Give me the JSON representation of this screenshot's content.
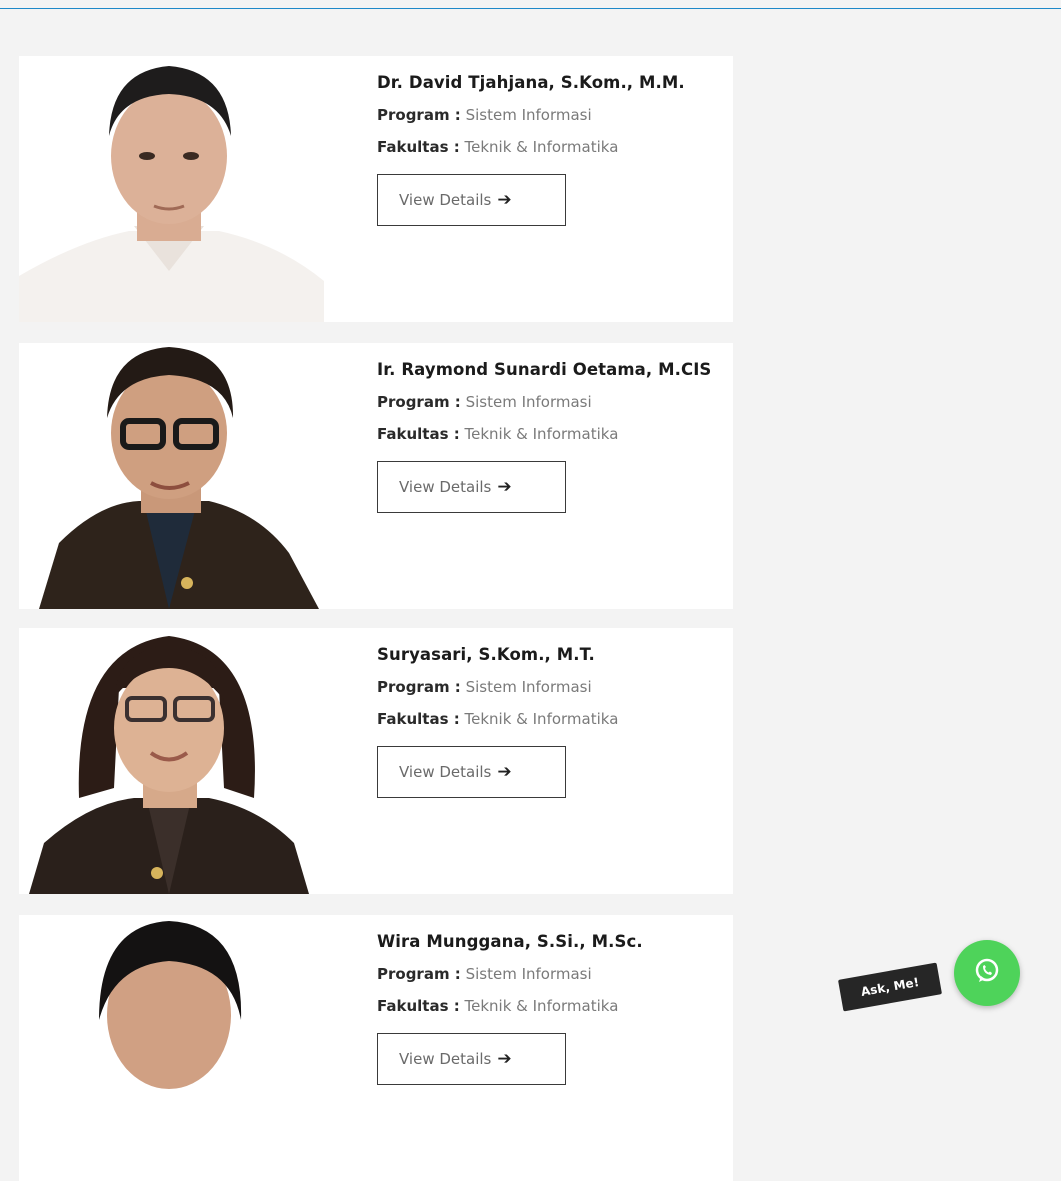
{
  "labels": {
    "program": "Program :",
    "fakultas": "Fakultas :",
    "view_details": "View Details"
  },
  "faculty": [
    {
      "name": "Dr. David Tjahjana, S.Kom., M.M.",
      "program": "Sistem Informasi",
      "fakultas": "Teknik & Informatika"
    },
    {
      "name": "Ir. Raymond Sunardi Oetama, M.CIS",
      "program": "Sistem Informasi",
      "fakultas": "Teknik & Informatika"
    },
    {
      "name": "Suryasari, S.Kom., M.T.",
      "program": "Sistem Informasi",
      "fakultas": "Teknik & Informatika"
    },
    {
      "name": "Wira Munggana, S.Si., M.Sc.",
      "program": "Sistem Informasi",
      "fakultas": "Teknik & Informatika"
    }
  ],
  "chat": {
    "ask_label": "Ask, Me!"
  },
  "icons": {
    "arrow": "arrow-right-icon",
    "chat": "whatsapp-icon"
  },
  "colors": {
    "accent_line": "#1e88c8",
    "whatsapp": "#4ed35a"
  }
}
